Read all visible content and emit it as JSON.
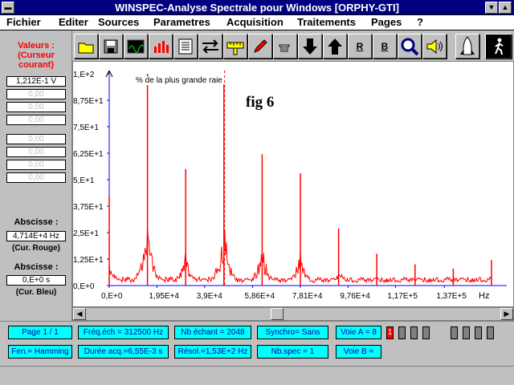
{
  "window": {
    "title": "WINSPEC-Analyse Spectrale pour Windows [ORPHY-GTI]"
  },
  "menu": [
    "Fichier",
    "Editer",
    "Sources",
    "Parametres",
    "Acquisition",
    "Traitements",
    "Pages",
    "?"
  ],
  "left": {
    "heading": [
      "Valeurs :",
      "(Curseur",
      "courant)"
    ],
    "values": [
      "1,212E-1 V",
      "0,00",
      "0,00",
      "0,00",
      "0,00",
      "0,00",
      "0,00",
      "0,00"
    ],
    "abscisse1_label": "Abscisse :",
    "abscisse1_value": "4,714E+4 Hz",
    "abscisse1_caption": "(Cur. Rouge)",
    "abscisse2_label": "Abscisse :",
    "abscisse2_value": "0,E+0 s",
    "abscisse2_caption": "(Cur.  Bleu)"
  },
  "toolbar": {
    "icons": [
      "folder-icon",
      "save-icon",
      "scope-icon",
      "bar-chart-icon",
      "list-icon",
      "arrows-icon",
      "ruler-icon",
      "pencil-icon",
      "hand-icon",
      "arrow-down-icon",
      "arrow-up-icon",
      "bold-r-icon",
      "bold-b-icon",
      "magnifier-icon",
      "speaker-icon",
      "shuttle-icon",
      "walker-icon"
    ],
    "r_label": "R",
    "b_label": "B"
  },
  "plot": {
    "annotation": "% de la plus grande raie",
    "fig_label": "fig 6",
    "unit_label": "Hz"
  },
  "chart_data": {
    "type": "line",
    "ylabel": "% de la plus grande raie",
    "xlabel": "Hz",
    "y_ticks": [
      "0,E+0",
      "1,25E+1",
      "2,5E+1",
      "3,75E+1",
      "5,E+1",
      "6,25E+1",
      "7,5E+1",
      "8,75E+1",
      "1,E+2"
    ],
    "x_ticks": [
      "0,E+0",
      "1,95E+4",
      "3,9E+4",
      "5,86E+4",
      "7,81E+4",
      "9,76E+4",
      "1,17E+5",
      "1,37E+5"
    ],
    "x_values": [
      0,
      19500,
      39000,
      58600,
      78100,
      97600,
      117000,
      137000
    ],
    "ylim": [
      0,
      100
    ],
    "xlim": [
      0,
      156250
    ],
    "peaks": [
      {
        "x": 0,
        "y": 42
      },
      {
        "x": 15625,
        "y": 100
      },
      {
        "x": 31250,
        "y": 55
      },
      {
        "x": 46875,
        "y": 95
      },
      {
        "x": 62500,
        "y": 62
      },
      {
        "x": 78125,
        "y": 53
      },
      {
        "x": 93750,
        "y": 27
      },
      {
        "x": 109375,
        "y": 15
      },
      {
        "x": 125000,
        "y": 10
      },
      {
        "x": 140625,
        "y": 8
      },
      {
        "x": 156250,
        "y": 12
      }
    ],
    "cursor_red_x": 47140,
    "colors": {
      "series": "#ff0000",
      "cursor_red": "#ff0000",
      "cursor_blue": "#0000ff",
      "fig_label": "#000000"
    }
  },
  "status": {
    "page": "Page   1 / 1",
    "freq": "Fréq.éch = 312500 Hz",
    "nb_echant": "Nb échant = 2048",
    "synchro": "Synchro= Sans",
    "voie_a": "Voie A = 8",
    "window_fn": "Fen.= Hamming",
    "duree": "Durée acq.=6,55E-3 s",
    "resol": "Résol.=1,53E+2 Hz",
    "nb_spec": "Nb.spec = 1",
    "voie_b": "Voie B =",
    "voice1_label": "1"
  }
}
